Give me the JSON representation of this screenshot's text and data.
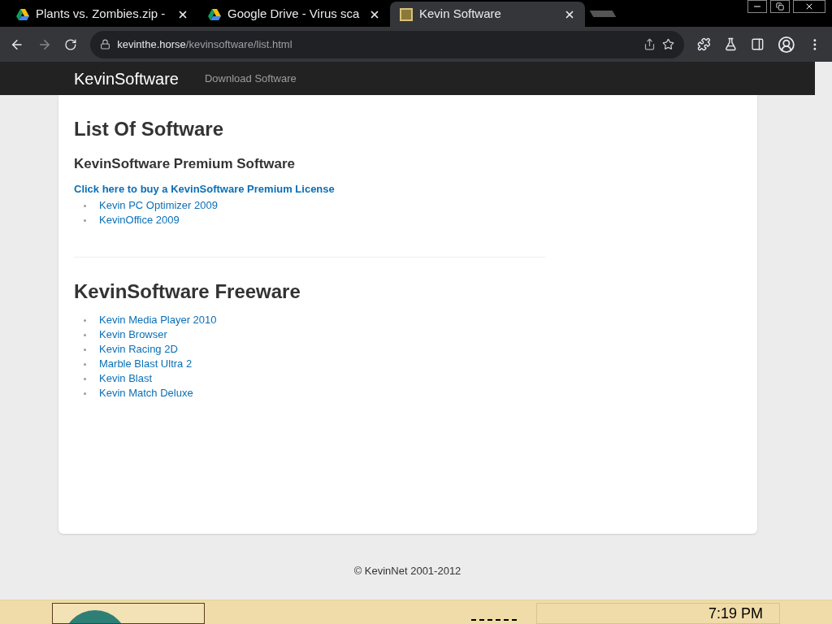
{
  "browser": {
    "tabs": [
      {
        "title": "Plants vs. Zombies.zip -",
        "kind": "drive",
        "selected": false
      },
      {
        "title": "Google Drive - Virus sca",
        "kind": "drive",
        "selected": false
      },
      {
        "title": "Kevin Software",
        "kind": "site",
        "selected": true
      }
    ],
    "address": {
      "host": "kevinthe.horse",
      "path": "/kevinsoftware/list.html"
    }
  },
  "navbar": {
    "brand": "KevinSoftware",
    "links": [
      "Download Software"
    ]
  },
  "page": {
    "title": "List Of Software",
    "sections": [
      {
        "heading": "KevinSoftware Premium Software",
        "kind": "subsection",
        "link": "Click here to buy a KevinSoftware Premium License",
        "items": [
          "Kevin PC Optimizer 2009",
          "KevinOffice 2009"
        ]
      },
      {
        "heading": "KevinSoftware Freeware",
        "kind": "section",
        "items": [
          "Kevin Media Player 2010",
          "Kevin Browser",
          "Kevin Racing 2D",
          "Marble Blast Ultra 2",
          "Kevin Blast",
          "Kevin Match Deluxe"
        ]
      }
    ]
  },
  "footer": "© KevinNet 2001-2012",
  "taskbar": {
    "clock": "7:19 PM"
  }
}
